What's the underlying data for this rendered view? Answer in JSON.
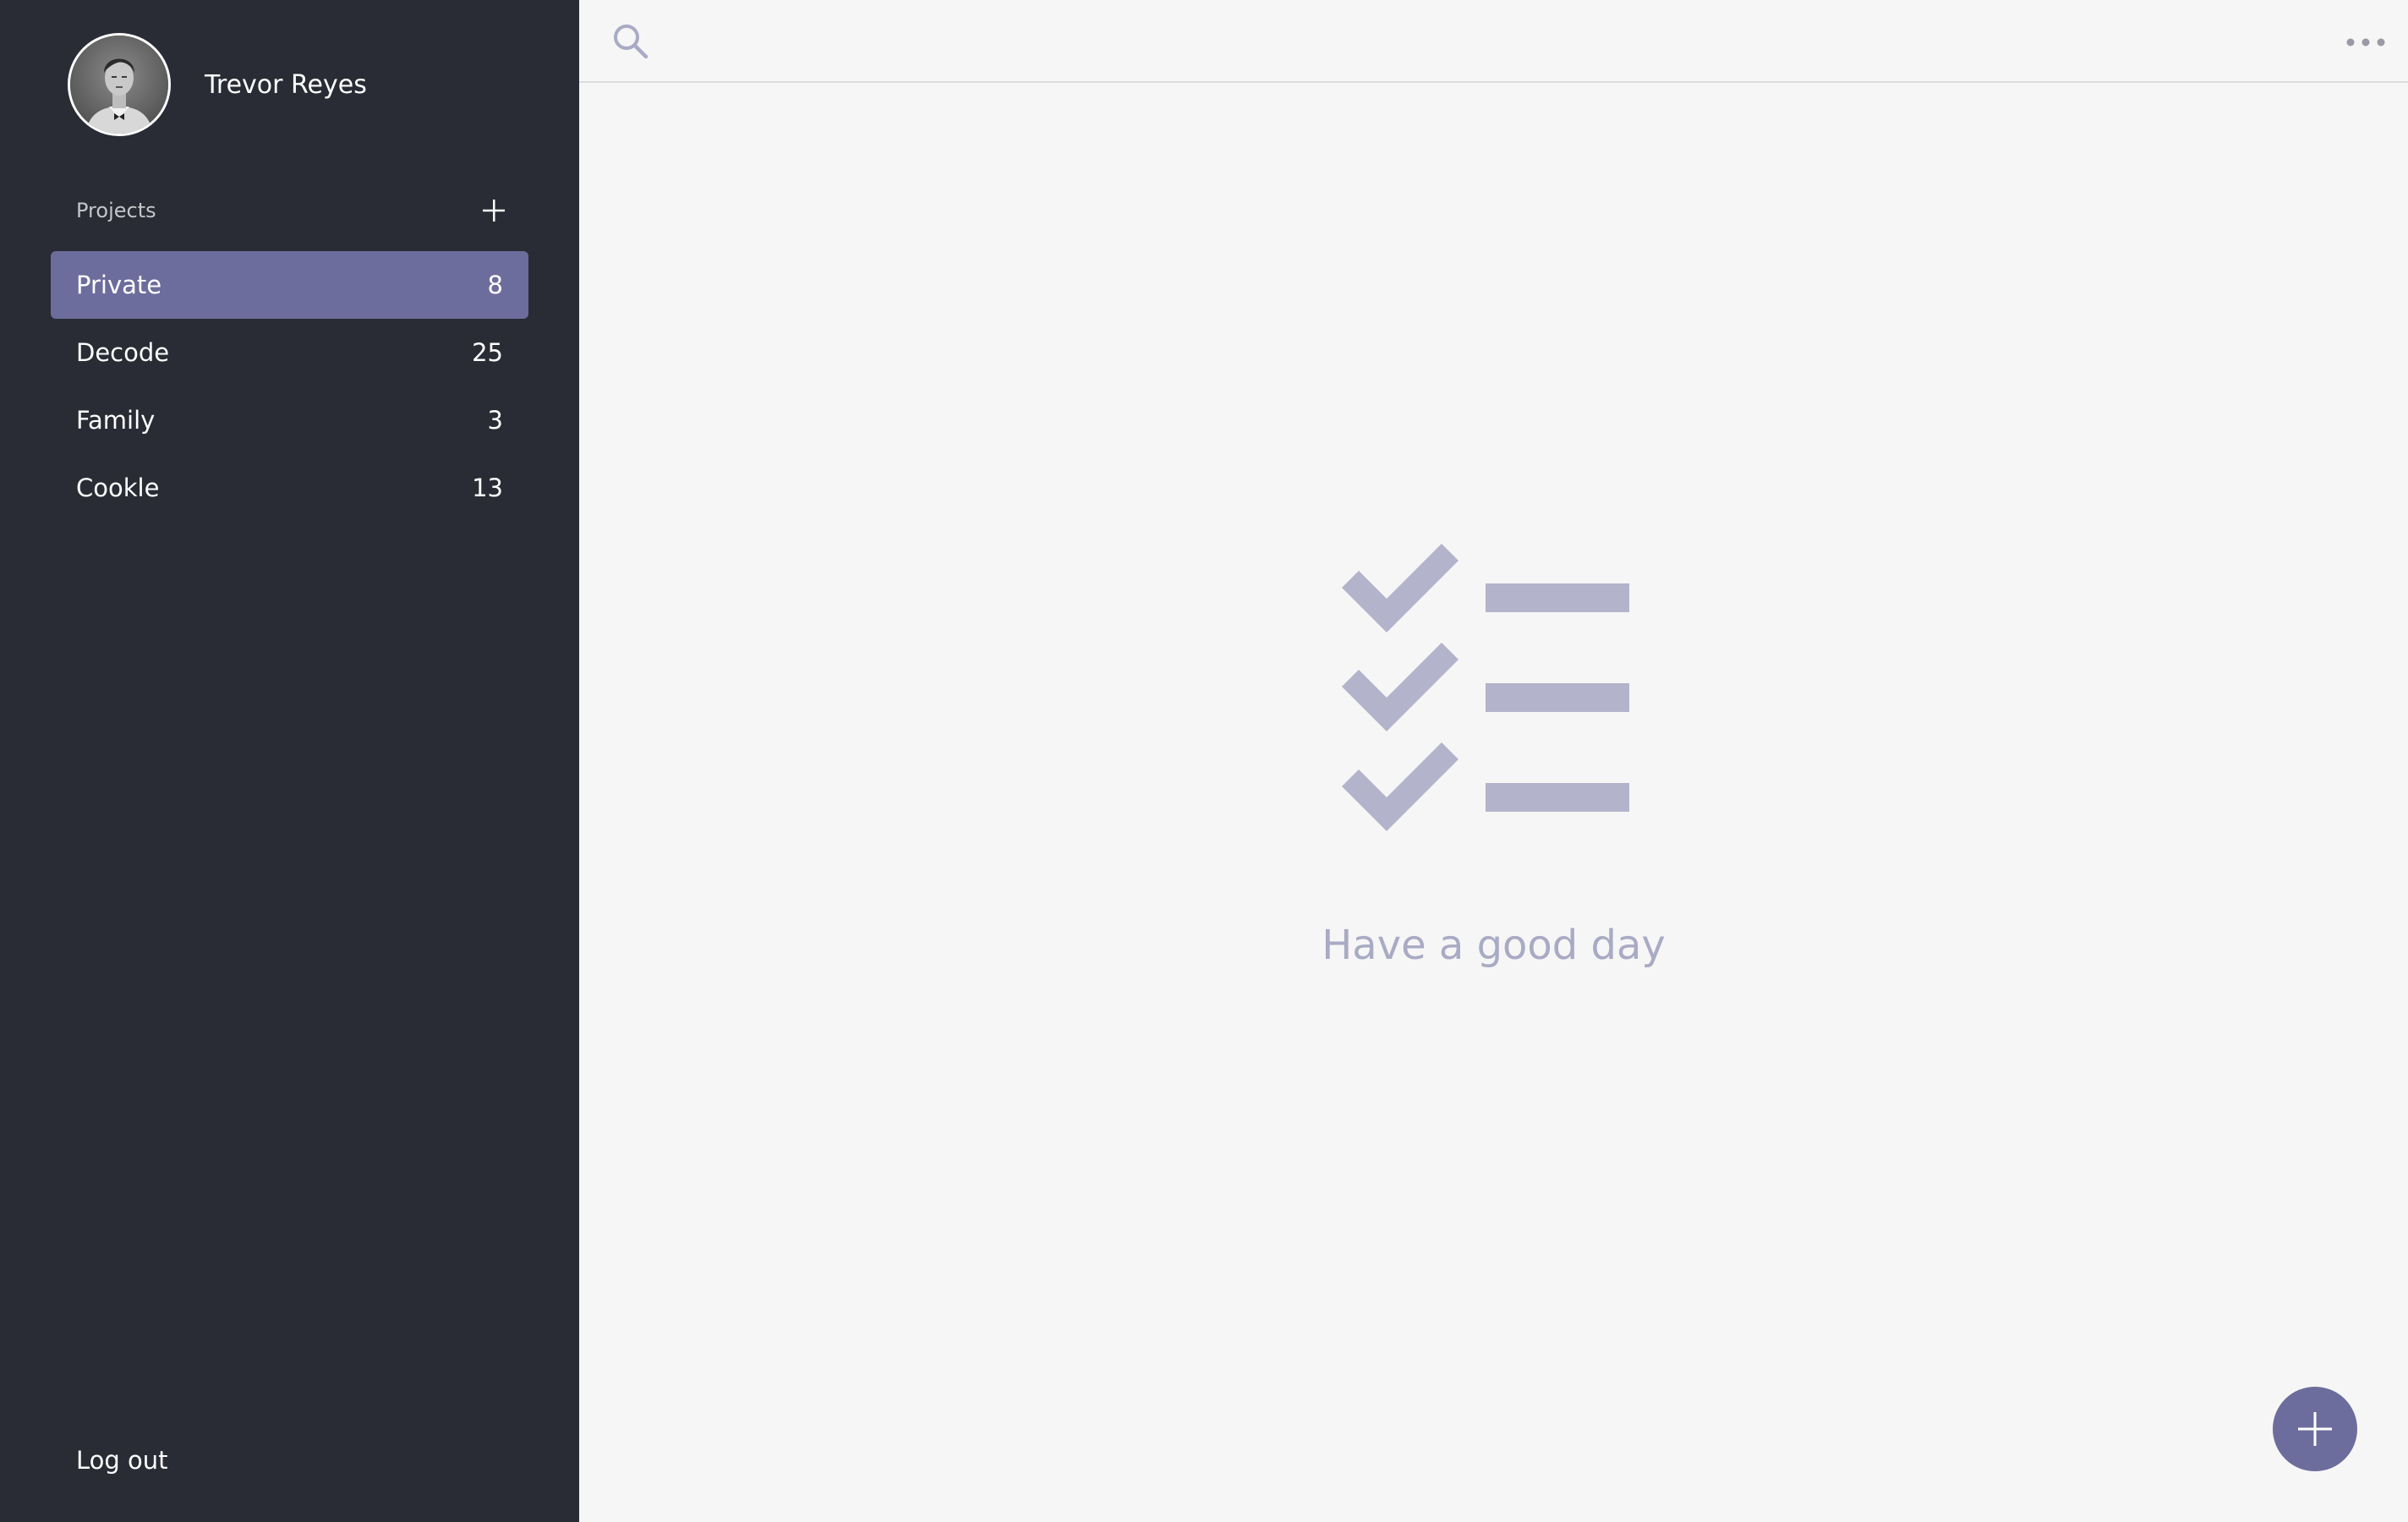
{
  "user": {
    "name": "Trevor Reyes",
    "avatar_icon": "user-avatar-photo"
  },
  "sidebar": {
    "projects_label": "Projects",
    "add_project_icon": "plus-icon",
    "projects": [
      {
        "label": "Private",
        "count": "8",
        "active": true
      },
      {
        "label": "Decode",
        "count": "25",
        "active": false
      },
      {
        "label": "Family",
        "count": "3",
        "active": false
      },
      {
        "label": "Cookle",
        "count": "13",
        "active": false
      }
    ],
    "logout_label": "Log out"
  },
  "topbar": {
    "search_icon": "search-icon",
    "more_icon": "more-horizontal-icon"
  },
  "empty_state": {
    "icon": "checklist-icon",
    "message": "Have a good day"
  },
  "fab": {
    "icon": "plus-icon"
  },
  "colors": {
    "sidebar_bg": "#292c34",
    "accent": "#6c6d9c",
    "main_bg": "#f6f6f6",
    "muted_illustration": "#b3b3cb",
    "muted_text": "#a9aac4"
  }
}
